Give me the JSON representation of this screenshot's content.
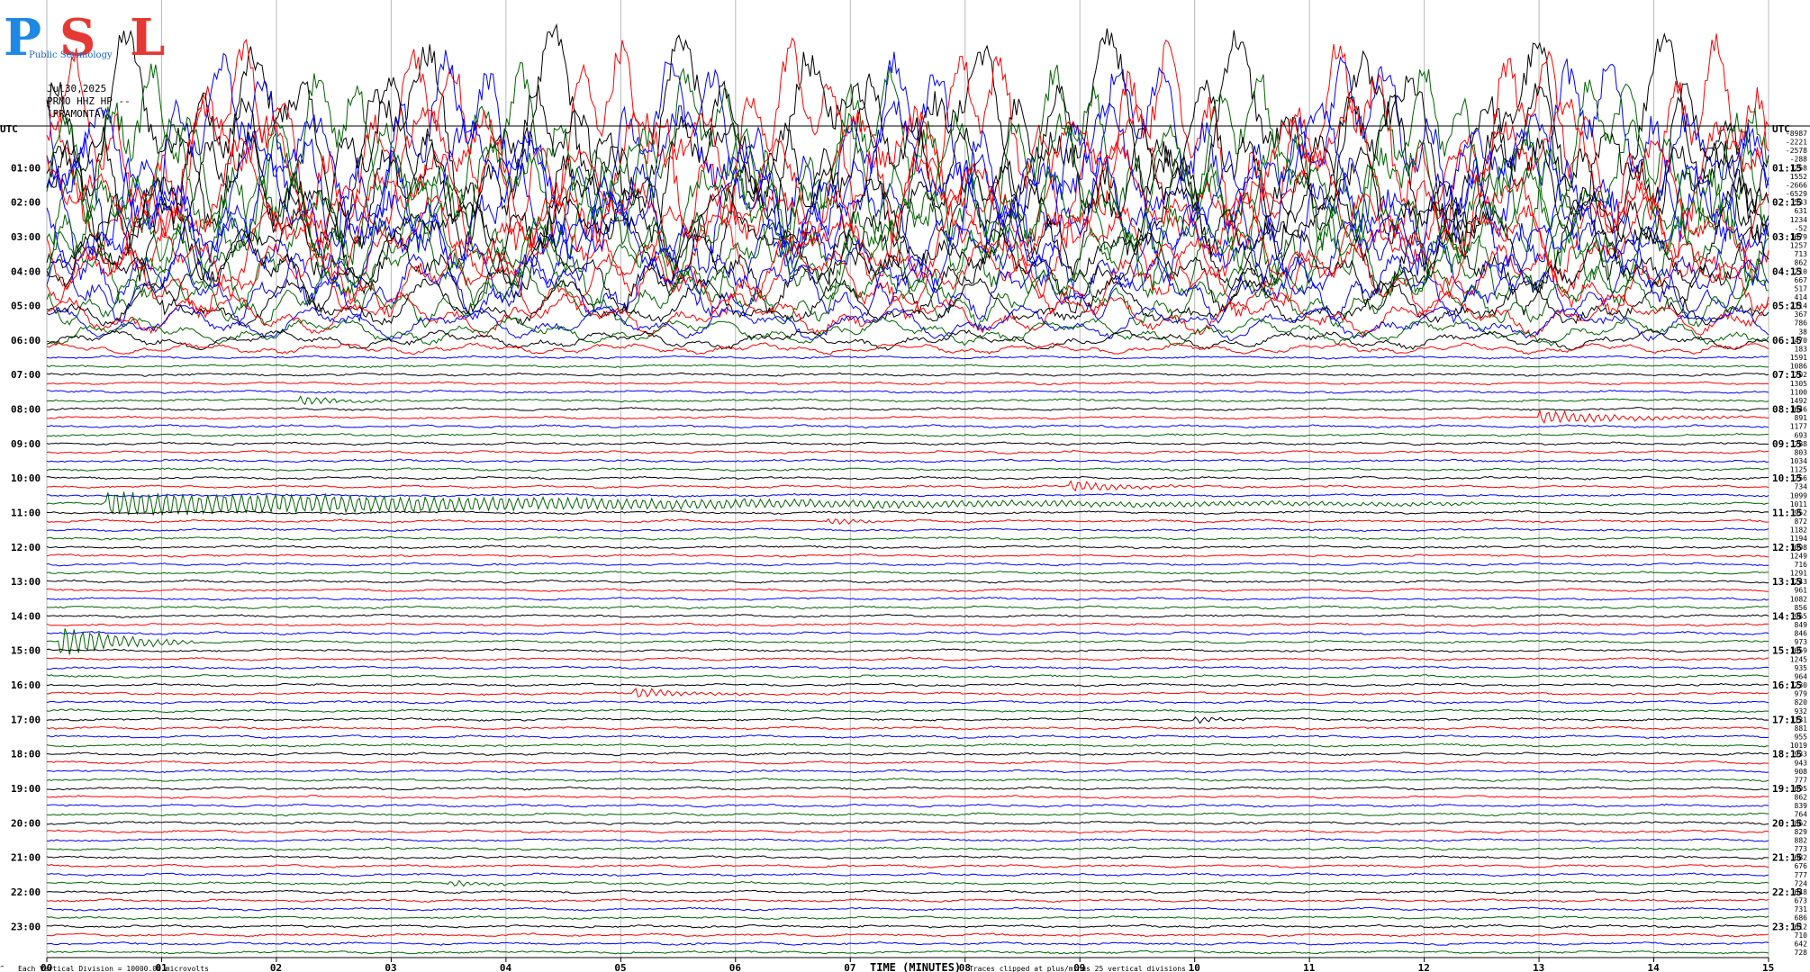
{
  "logo": {
    "letters": [
      "P",
      "S",
      "L"
    ],
    "subtitle": "Public Seismology",
    "colors": {
      "P": "#1e88e5",
      "S": "#e53935",
      "L": "#e53935"
    }
  },
  "header": {
    "date": "Jul30,2025",
    "station": "PRMO HHZ HP --",
    "site": "(PRAMONTA)"
  },
  "utc_label": "UTC",
  "footer": {
    "scale_note": "Each Vertical Division = 10000.00 microvolts",
    "clip_note": "Traces clipped at plus/minus 25 vertical divisions",
    "corner_mark": "‴"
  },
  "chart_data": {
    "type": "line",
    "kind": "helicorder",
    "xlabel": "TIME (MINUTES)",
    "xlim": [
      0,
      15
    ],
    "x_ticks": [
      "00",
      "01",
      "02",
      "03",
      "04",
      "05",
      "06",
      "07",
      "08",
      "09",
      "10",
      "11",
      "12",
      "13",
      "14",
      "15"
    ],
    "minutes_per_line": 15,
    "left_time_labels": [
      "01:00",
      "02:00",
      "03:00",
      "04:00",
      "05:00",
      "06:00",
      "07:00",
      "08:00",
      "09:00",
      "10:00",
      "11:00",
      "12:00",
      "13:00",
      "14:00",
      "15:00",
      "16:00",
      "17:00",
      "18:00",
      "19:00",
      "20:00",
      "21:00",
      "22:00",
      "23:00"
    ],
    "right_time_labels": [
      "01:15",
      "02:15",
      "03:15",
      "04:15",
      "05:15",
      "06:15",
      "07:15",
      "08:15",
      "09:15",
      "10:15",
      "11:15",
      "12:15",
      "13:15",
      "14:15",
      "15:15",
      "16:15",
      "17:15",
      "18:15",
      "19:15",
      "20:15",
      "21:15",
      "22:15",
      "23:15"
    ],
    "line_colors": [
      "#000000",
      "#ff0000",
      "#0000ff",
      "#006400"
    ],
    "clip_divisions": 25,
    "trace_values": [
      "-8987",
      "-2221",
      "-2578",
      "-288",
      "1258",
      "1552",
      "-2666",
      "-6529",
      "533",
      "631",
      "1234",
      "-52",
      "1679",
      "1257",
      "713",
      "862",
      "210",
      "667",
      "517",
      "414",
      "2114",
      "367",
      "786",
      "38",
      "470",
      "183",
      "1591",
      "1086",
      "702",
      "1305",
      "1100",
      "1492",
      "1646",
      "891",
      "1177",
      "693",
      "788",
      "803",
      "1034",
      "1125",
      "756",
      "734",
      "1099",
      "1011",
      "952",
      "872",
      "1182",
      "1194",
      "1098",
      "1249",
      "716",
      "1291",
      "1243",
      "961",
      "1082",
      "856",
      "965",
      "849",
      "846",
      "973",
      "1059",
      "1245",
      "935",
      "964",
      "1230",
      "979",
      "820",
      "932",
      "1131",
      "881",
      "955",
      "1019",
      "933",
      "943",
      "908",
      "777",
      "695",
      "862",
      "839",
      "764",
      "862",
      "829",
      "882",
      "773",
      "682",
      "676",
      "777",
      "724",
      "648",
      "673",
      "731",
      "686",
      "612",
      "710",
      "642",
      "728"
    ],
    "events": [
      {
        "line_start": "07:45",
        "minute": 2.2,
        "amplitude": 0.8,
        "duration_min": 0.8
      },
      {
        "line_start": "08:15",
        "minute": 13.0,
        "amplitude": 1.2,
        "duration_min": 1.8
      },
      {
        "line_start": "10:15",
        "minute": 8.9,
        "amplitude": 1.0,
        "duration_min": 1.2
      },
      {
        "line_start": "10:45",
        "minute": 0.5,
        "amplitude": 2.2,
        "duration_min": 12.0
      },
      {
        "line_start": "11:15",
        "minute": 6.8,
        "amplitude": 0.6,
        "duration_min": 0.9
      },
      {
        "line_start": "14:45",
        "minute": 0.1,
        "amplitude": 3.0,
        "duration_min": 1.2
      },
      {
        "line_start": "16:15",
        "minute": 5.1,
        "amplitude": 1.0,
        "duration_min": 1.0
      },
      {
        "line_start": "17:00",
        "minute": 10.0,
        "amplitude": 0.7,
        "duration_min": 0.5
      },
      {
        "line_start": "21:45",
        "minute": 3.5,
        "amplitude": 0.6,
        "duration_min": 0.8
      }
    ]
  }
}
